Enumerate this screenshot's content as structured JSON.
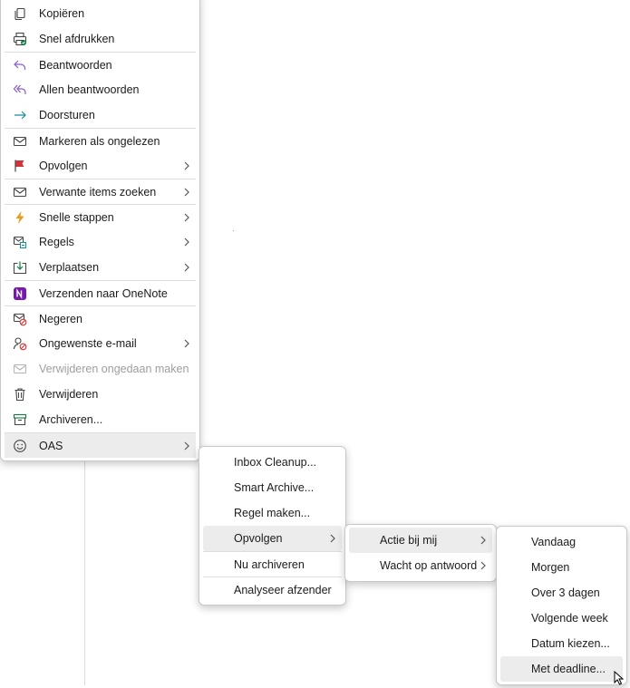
{
  "context_menu": {
    "items": [
      {
        "label": "Kopiëren",
        "icon": "copy-icon"
      },
      {
        "label": "Snel afdrukken",
        "icon": "quick-print-icon"
      },
      {
        "label": "Beantwoorden",
        "icon": "reply-icon"
      },
      {
        "label": "Allen beantwoorden",
        "icon": "reply-all-icon"
      },
      {
        "label": "Doorsturen",
        "icon": "forward-icon"
      },
      {
        "label": "Markeren als ongelezen",
        "icon": "envelope-icon"
      },
      {
        "label": "Opvolgen",
        "icon": "flag-icon"
      },
      {
        "label": "Verwante items zoeken",
        "icon": "envelope-icon"
      },
      {
        "label": "Snelle stappen",
        "icon": "lightning-icon"
      },
      {
        "label": "Regels",
        "icon": "rules-icon"
      },
      {
        "label": "Verplaatsen",
        "icon": "move-icon"
      },
      {
        "label": "Verzenden naar OneNote",
        "icon": "onenote-icon"
      },
      {
        "label": "Negeren",
        "icon": "ignore-icon"
      },
      {
        "label": "Ongewenste e-mail",
        "icon": "junk-icon"
      },
      {
        "label": "Verwijderen ongedaan maken",
        "icon": "undo-delete-icon"
      },
      {
        "label": "Verwijderen",
        "icon": "trash-icon"
      },
      {
        "label": "Archiveren...",
        "icon": "archive-icon"
      },
      {
        "label": "OAS",
        "icon": "smiley-icon"
      }
    ]
  },
  "oas_submenu": {
    "items": [
      {
        "label": "Inbox Cleanup..."
      },
      {
        "label": "Smart Archive..."
      },
      {
        "label": "Regel maken..."
      },
      {
        "label": "Opvolgen"
      },
      {
        "label": "Nu archiveren"
      },
      {
        "label": "Analyseer afzender"
      }
    ]
  },
  "opvolgen_submenu": {
    "items": [
      {
        "label": "Actie bij mij"
      },
      {
        "label": "Wacht op antwoord"
      }
    ]
  },
  "actie_submenu": {
    "items": [
      {
        "label": "Vandaag"
      },
      {
        "label": "Morgen"
      },
      {
        "label": "Over 3 dagen"
      },
      {
        "label": "Volgende week"
      },
      {
        "label": "Datum kiezen..."
      },
      {
        "label": "Met deadline..."
      }
    ]
  },
  "colors": {
    "hover_bg": "#ececec",
    "flag_red": "#d13438",
    "reply_purple": "#8a5cc8",
    "forward_teal": "#1b8e9c",
    "lightning_orange": "#e89a1a",
    "onenote_purple": "#7719aa",
    "archive_green": "#107c41",
    "disabled_text": "#9e9e9e"
  }
}
